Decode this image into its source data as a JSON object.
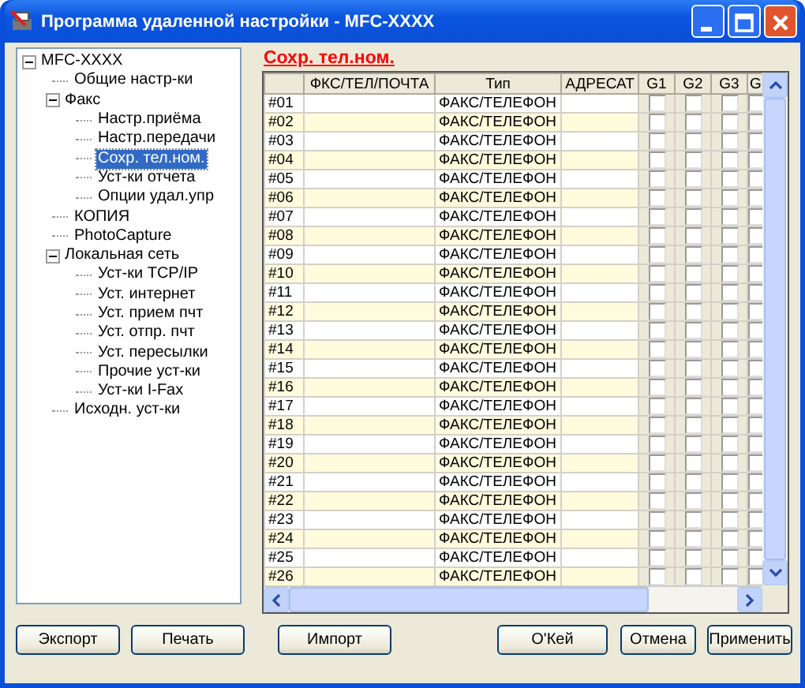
{
  "window": {
    "title": "Программа удаленной настройки - MFC-XXXX"
  },
  "tree": [
    {
      "label": "MFC-XXXX",
      "expanded": true,
      "selected": false,
      "children": [
        {
          "label": "Общие настр-ки",
          "selected": false
        },
        {
          "label": "Факс",
          "expanded": true,
          "selected": false,
          "children": [
            {
              "label": "Настр.приёма",
              "selected": false
            },
            {
              "label": "Настр.передачи",
              "selected": false
            },
            {
              "label": "Сохр. тел.ном.",
              "selected": true
            },
            {
              "label": "Уст-ки отчета",
              "selected": false
            },
            {
              "label": "Опции удал.упр",
              "selected": false
            }
          ]
        },
        {
          "label": "КОПИЯ",
          "selected": false
        },
        {
          "label": "PhotoCapture",
          "selected": false
        },
        {
          "label": "Локальная сеть",
          "expanded": true,
          "selected": false,
          "children": [
            {
              "label": "Уст-ки TCP/IP",
              "selected": false
            },
            {
              "label": "Уст. интернет",
              "selected": false
            },
            {
              "label": "Уст. прием пчт",
              "selected": false
            },
            {
              "label": "Уст. отпр. пчт",
              "selected": false
            },
            {
              "label": "Уст. пересылки",
              "selected": false
            },
            {
              "label": "Прочие уст-ки",
              "selected": false
            },
            {
              "label": "Уст-ки I-Fax",
              "selected": false
            }
          ]
        },
        {
          "label": "Исходн. уст-ки",
          "selected": false
        }
      ]
    }
  ],
  "section_title": "Сохр. тел.ном.",
  "table": {
    "columns": [
      "ФКС/ТЕЛ/ПОЧТА",
      "Тип",
      "АДРЕСАТ",
      "G1",
      "G2",
      "G3",
      "G"
    ],
    "rows": [
      {
        "number": "#01",
        "type": "ФАКС/ТЕЛЕФОН",
        "groups": [
          false,
          false,
          false,
          false
        ]
      },
      {
        "number": "#02",
        "type": "ФАКС/ТЕЛЕФОН",
        "groups": [
          false,
          false,
          false,
          false
        ]
      },
      {
        "number": "#03",
        "type": "ФАКС/ТЕЛЕФОН",
        "groups": [
          false,
          false,
          false,
          false
        ]
      },
      {
        "number": "#04",
        "type": "ФАКС/ТЕЛЕФОН",
        "groups": [
          false,
          false,
          false,
          false
        ]
      },
      {
        "number": "#05",
        "type": "ФАКС/ТЕЛЕФОН",
        "groups": [
          false,
          false,
          false,
          false
        ]
      },
      {
        "number": "#06",
        "type": "ФАКС/ТЕЛЕФОН",
        "groups": [
          false,
          false,
          false,
          false
        ]
      },
      {
        "number": "#07",
        "type": "ФАКС/ТЕЛЕФОН",
        "groups": [
          false,
          false,
          false,
          false
        ]
      },
      {
        "number": "#08",
        "type": "ФАКС/ТЕЛЕФОН",
        "groups": [
          false,
          false,
          false,
          false
        ]
      },
      {
        "number": "#09",
        "type": "ФАКС/ТЕЛЕФОН",
        "groups": [
          false,
          false,
          false,
          false
        ]
      },
      {
        "number": "#10",
        "type": "ФАКС/ТЕЛЕФОН",
        "groups": [
          false,
          false,
          false,
          false
        ]
      },
      {
        "number": "#11",
        "type": "ФАКС/ТЕЛЕФОН",
        "groups": [
          false,
          false,
          false,
          false
        ]
      },
      {
        "number": "#12",
        "type": "ФАКС/ТЕЛЕФОН",
        "groups": [
          false,
          false,
          false,
          false
        ]
      },
      {
        "number": "#13",
        "type": "ФАКС/ТЕЛЕФОН",
        "groups": [
          false,
          false,
          false,
          false
        ]
      },
      {
        "number": "#14",
        "type": "ФАКС/ТЕЛЕФОН",
        "groups": [
          false,
          false,
          false,
          false
        ]
      },
      {
        "number": "#15",
        "type": "ФАКС/ТЕЛЕФОН",
        "groups": [
          false,
          false,
          false,
          false
        ]
      },
      {
        "number": "#16",
        "type": "ФАКС/ТЕЛЕФОН",
        "groups": [
          false,
          false,
          false,
          false
        ]
      },
      {
        "number": "#17",
        "type": "ФАКС/ТЕЛЕФОН",
        "groups": [
          false,
          false,
          false,
          false
        ]
      },
      {
        "number": "#18",
        "type": "ФАКС/ТЕЛЕФОН",
        "groups": [
          false,
          false,
          false,
          false
        ]
      },
      {
        "number": "#19",
        "type": "ФАКС/ТЕЛЕФОН",
        "groups": [
          false,
          false,
          false,
          false
        ]
      },
      {
        "number": "#20",
        "type": "ФАКС/ТЕЛЕФОН",
        "groups": [
          false,
          false,
          false,
          false
        ]
      },
      {
        "number": "#21",
        "type": "ФАКС/ТЕЛЕФОН",
        "groups": [
          false,
          false,
          false,
          false
        ]
      },
      {
        "number": "#22",
        "type": "ФАКС/ТЕЛЕФОН",
        "groups": [
          false,
          false,
          false,
          false
        ]
      },
      {
        "number": "#23",
        "type": "ФАКС/ТЕЛЕФОН",
        "groups": [
          false,
          false,
          false,
          false
        ]
      },
      {
        "number": "#24",
        "type": "ФАКС/ТЕЛЕФОН",
        "groups": [
          false,
          false,
          false,
          false
        ]
      },
      {
        "number": "#25",
        "type": "ФАКС/ТЕЛЕФОН",
        "groups": [
          false,
          false,
          false,
          false
        ]
      },
      {
        "number": "#26",
        "type": "ФАКС/ТЕЛЕФОН",
        "groups": [
          false,
          false,
          false,
          false
        ]
      }
    ]
  },
  "buttons_left": [
    "Экспорт",
    "Печать",
    "Импорт"
  ],
  "buttons_right": [
    "О'Кей",
    "Отмена",
    "Применить"
  ]
}
